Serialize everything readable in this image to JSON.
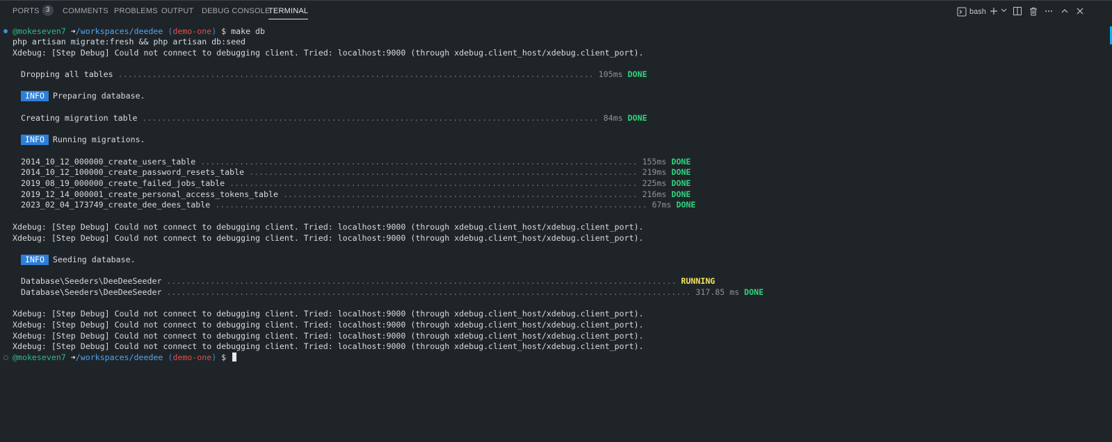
{
  "panel": {
    "tabs": [
      {
        "label": "PORTS",
        "badge": "3"
      },
      {
        "label": "COMMENTS"
      },
      {
        "label": "PROBLEMS"
      },
      {
        "label": "OUTPUT"
      },
      {
        "label": "DEBUG CONSOLE"
      },
      {
        "label": "TERMINAL",
        "active": true
      }
    ],
    "toolbar": {
      "shell_label": "bash",
      "icons": [
        "terminal-icon",
        "plus-icon",
        "chevron-down-icon",
        "split-icon",
        "trash-icon",
        "more-icon",
        "maximize-icon",
        "close-icon"
      ]
    }
  },
  "terminal": {
    "prompt": {
      "user": "@mokeseven7",
      "arrow": "➜",
      "path": "/workspaces/deedee",
      "branch": "demo-one",
      "symbol": "$"
    },
    "command": "make db",
    "lines": {
      "echo": "php artisan migrate:fresh && php artisan db:seed",
      "xdebug": "Xdebug: [Step Debug] Could not connect to debugging client. Tried: localhost:9000 (through xdebug.client_host/xdebug.client_port)."
    },
    "tasks": [
      {
        "name": "Dropping all tables",
        "duration": "105ms",
        "status": "DONE"
      },
      {
        "name": "Creating migration table",
        "duration": "84ms",
        "status": "DONE"
      },
      {
        "name": "2014_10_12_000000_create_users_table",
        "duration": "155ms",
        "status": "DONE"
      },
      {
        "name": "2014_10_12_100000_create_password_resets_table",
        "duration": "219ms",
        "status": "DONE"
      },
      {
        "name": "2019_08_19_000000_create_failed_jobs_table",
        "duration": "225ms",
        "status": "DONE"
      },
      {
        "name": "2019_12_14_000001_create_personal_access_tokens_table",
        "duration": "216ms",
        "status": "DONE"
      },
      {
        "name": "2023_02_04_173749_create_dee_dees_table",
        "duration": "67ms",
        "status": "DONE"
      },
      {
        "name": "Database\\Seeders\\DeeDeeSeeder",
        "duration": "",
        "status": "RUNNING"
      },
      {
        "name": "Database\\Seeders\\DeeDeeSeeder",
        "duration": "317.85 ms",
        "status": "DONE"
      }
    ],
    "info": [
      {
        "badge": "INFO",
        "text": "Preparing database."
      },
      {
        "badge": "INFO",
        "text": "Running migrations."
      },
      {
        "badge": "INFO",
        "text": "Seeding database."
      }
    ]
  },
  "colors": {
    "background": "#1f2428",
    "user": "#2fb989",
    "path": "#4ea5f0",
    "branch": "#e0504a",
    "done": "#2fd37e",
    "running": "#f5e45c",
    "info_badge": "#2d7fd9"
  }
}
